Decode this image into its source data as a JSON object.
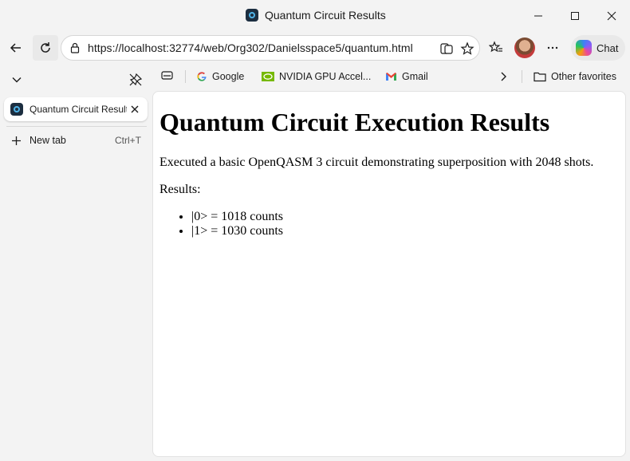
{
  "window": {
    "title": "Quantum Circuit Results"
  },
  "toolbar": {
    "url": "https://localhost:32774/web/Org302/Danielsspace5/quantum.html",
    "chat_label": "Chat"
  },
  "bookmarks": {
    "items": [
      {
        "label": "Google",
        "icon": "google-icon"
      },
      {
        "label": "NVIDIA GPU Accel...",
        "icon": "nvidia-icon"
      },
      {
        "label": "Gmail",
        "icon": "gmail-icon"
      }
    ],
    "other_favorites": "Other favorites"
  },
  "sidebar": {
    "active_tab_title": "Quantum Circuit Results",
    "new_tab_label": "New tab",
    "new_tab_shortcut": "Ctrl+T"
  },
  "page": {
    "heading": "Quantum Circuit Execution Results",
    "description": "Executed a basic OpenQASM 3 circuit demonstrating superposition with 2048 shots.",
    "results_label": "Results:",
    "results": [
      "|0> = 1018 counts",
      "|1> = 1030 counts"
    ]
  },
  "colors": {
    "chrome_bg": "#f3f3f3",
    "page_bg": "#ffffff",
    "accent": "#1c2e40"
  }
}
